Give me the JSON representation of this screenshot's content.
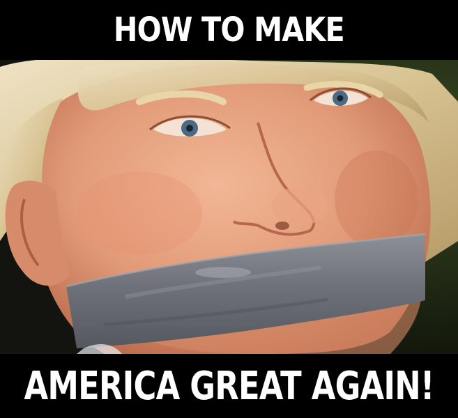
{
  "captions": {
    "top": "HOW TO MAKE",
    "bottom": "AMERICA GREAT AGAIN!"
  },
  "colors": {
    "caption_background": "#000000",
    "caption_text": "#ffffff",
    "skin": "#e5a07e",
    "hair": "#d9c49a",
    "tape": "#74777e",
    "foliage": "#2e3a1e"
  },
  "photo": {
    "subject": "close-up face with duct tape over mouth"
  }
}
